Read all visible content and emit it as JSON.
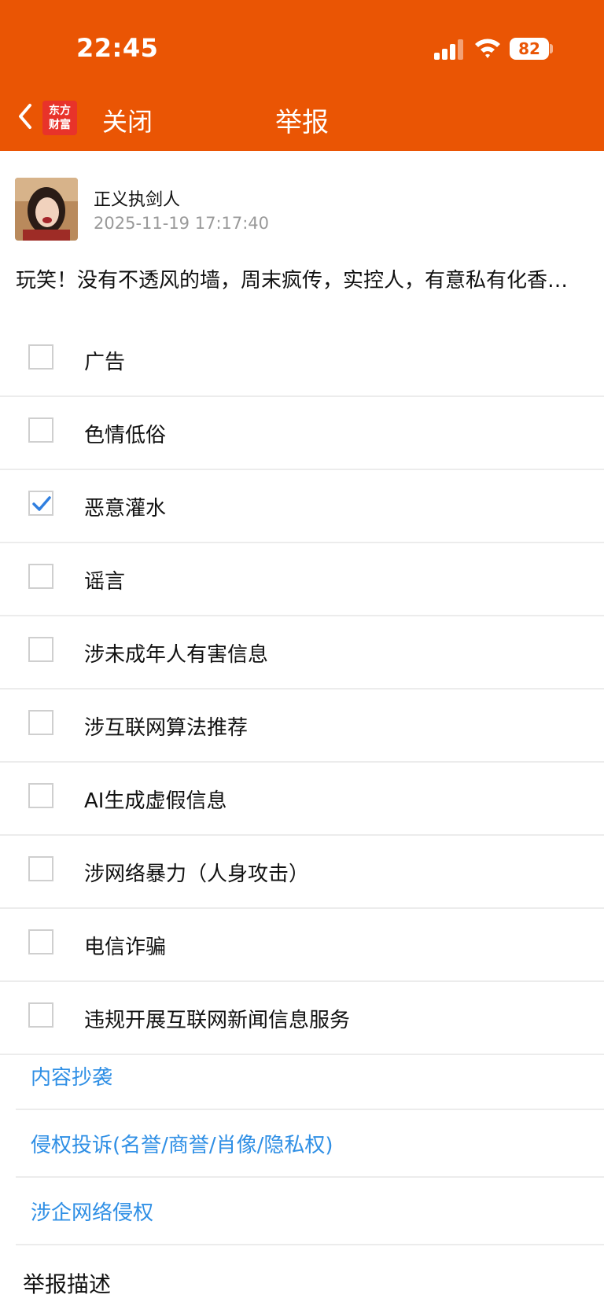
{
  "status_bar": {
    "time": "22:45",
    "battery": "82"
  },
  "nav": {
    "logo_line1": "东方",
    "logo_line2": "财富",
    "close_label": "关闭",
    "title": "举报"
  },
  "post": {
    "author": "正义执剑人",
    "time": "2025-11-19 17:17:40",
    "text": "玩笑！没有不透风的墙，周末疯传，实控人，有意私有化香港上市"
  },
  "options": [
    {
      "label": "广告",
      "checked": false
    },
    {
      "label": "色情低俗",
      "checked": false
    },
    {
      "label": "恶意灌水",
      "checked": true
    },
    {
      "label": "谣言",
      "checked": false
    },
    {
      "label": "涉未成年人有害信息",
      "checked": false
    },
    {
      "label": "涉互联网算法推荐",
      "checked": false
    },
    {
      "label": "AI生成虚假信息",
      "checked": false
    },
    {
      "label": "涉网络暴力（人身攻击）",
      "checked": false
    },
    {
      "label": "电信诈骗",
      "checked": false
    },
    {
      "label": "违规开展互联网新闻信息服务",
      "checked": false
    }
  ],
  "links": [
    {
      "label": "内容抄袭"
    },
    {
      "label": "侵权投诉(名誉/商誉/肖像/隐私权)"
    },
    {
      "label": "涉企网络侵权"
    }
  ],
  "description_title": "举报描述",
  "colors": {
    "header": "#ea5504",
    "link": "#2f8fe5",
    "check": "#2f7fe0"
  }
}
